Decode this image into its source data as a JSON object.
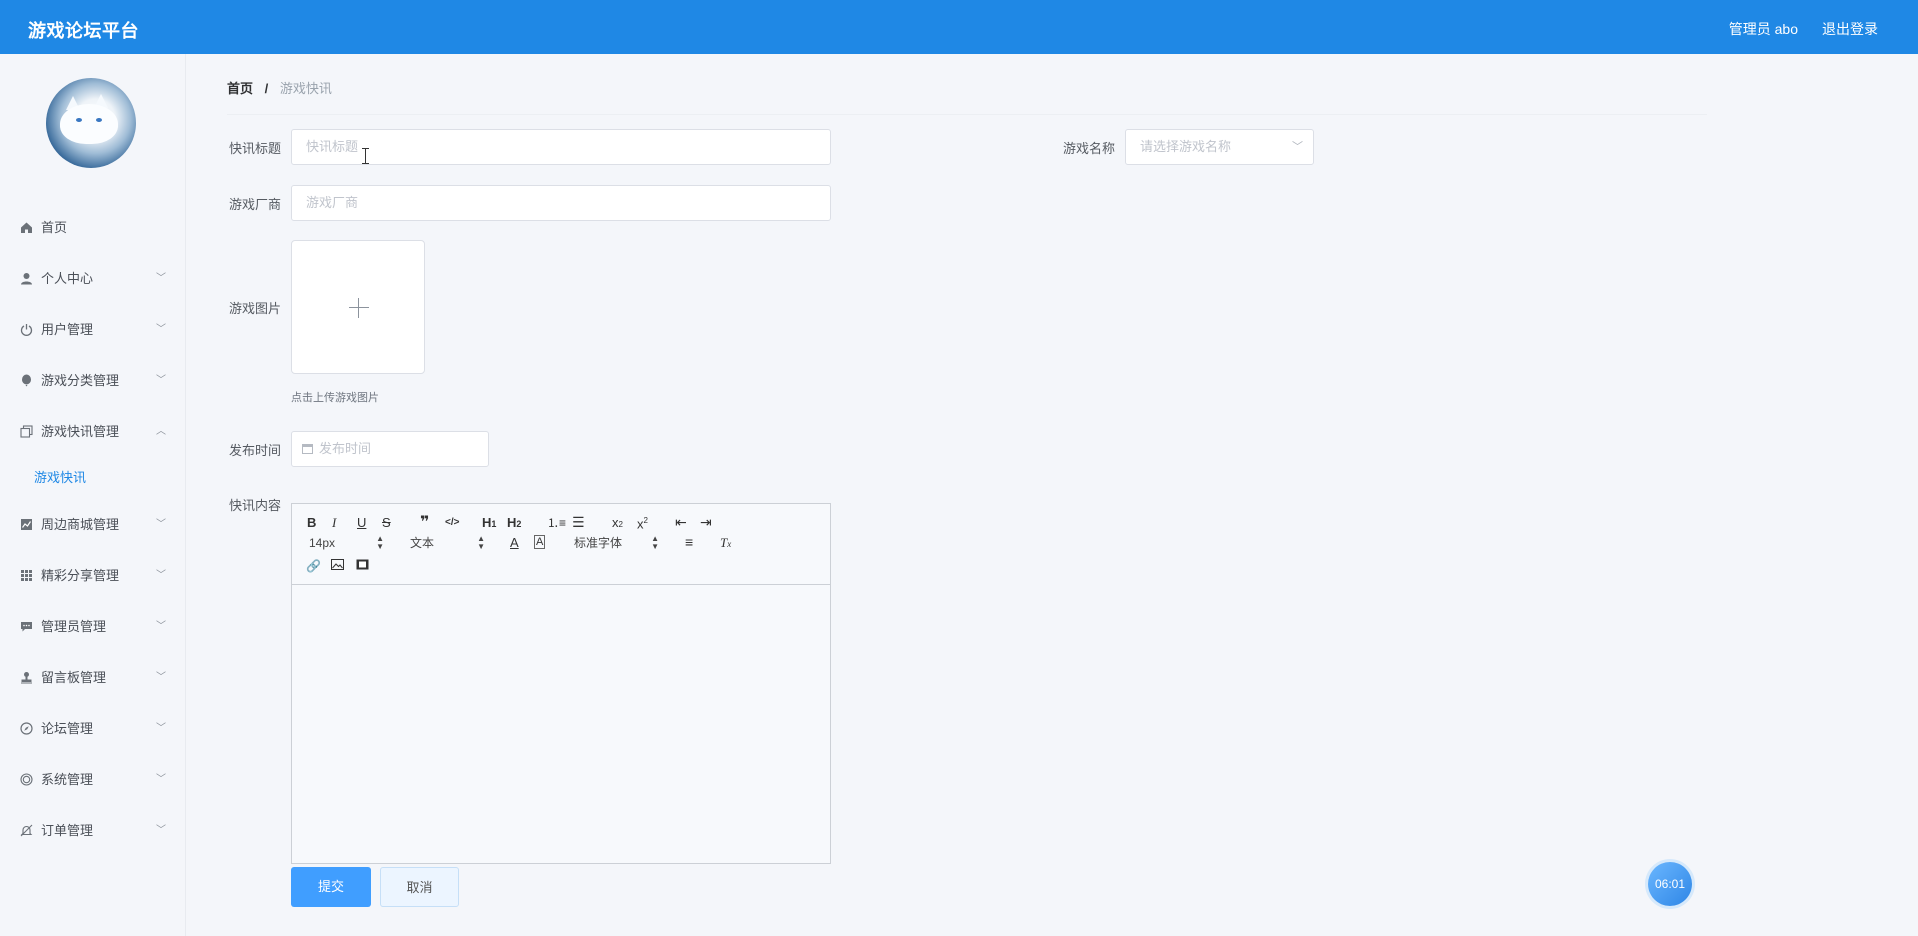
{
  "header": {
    "brand": "游戏论坛平台",
    "admin": "管理员 abo",
    "logout": "退出登录",
    "accent_color": "#1f88e5"
  },
  "sidebar": {
    "items": [
      {
        "label": "首页",
        "icon": "home-icon",
        "expandable": false
      },
      {
        "label": "个人中心",
        "icon": "user-icon",
        "expandable": true
      },
      {
        "label": "用户管理",
        "icon": "power-icon",
        "expandable": true
      },
      {
        "label": "游戏分类管理",
        "icon": "balloon-icon",
        "expandable": true
      },
      {
        "label": "游戏快讯管理",
        "icon": "copy-icon",
        "expandable": true,
        "expanded": true,
        "children": [
          {
            "label": "游戏快讯"
          }
        ]
      },
      {
        "label": "周边商城管理",
        "icon": "chart-icon",
        "expandable": true
      },
      {
        "label": "精彩分享管理",
        "icon": "grid-icon",
        "expandable": true
      },
      {
        "label": "管理员管理",
        "icon": "message-icon",
        "expandable": true
      },
      {
        "label": "留言板管理",
        "icon": "stamp-icon",
        "expandable": true
      },
      {
        "label": "论坛管理",
        "icon": "compass-icon",
        "expandable": true
      },
      {
        "label": "系统管理",
        "icon": "globe-icon",
        "expandable": true
      },
      {
        "label": "订单管理",
        "icon": "bell-off-icon",
        "expandable": true
      }
    ]
  },
  "breadcrumb": {
    "home": "首页",
    "separator": "/",
    "current": "游戏快讯"
  },
  "form": {
    "title_label": "快讯标题",
    "title_placeholder": "快讯标题",
    "game_name_label": "游戏名称",
    "game_name_placeholder": "请选择游戏名称",
    "vendor_label": "游戏厂商",
    "vendor_placeholder": "游戏厂商",
    "image_label": "游戏图片",
    "image_tip": "点击上传游戏图片",
    "publish_label": "发布时间",
    "publish_placeholder": "发布时间",
    "content_label": "快讯内容",
    "editor": {
      "font_size": "14px",
      "header_select": "文本",
      "font_family": "标准字体"
    },
    "submit": "提交",
    "cancel": "取消"
  },
  "floating_badge": "06:01"
}
